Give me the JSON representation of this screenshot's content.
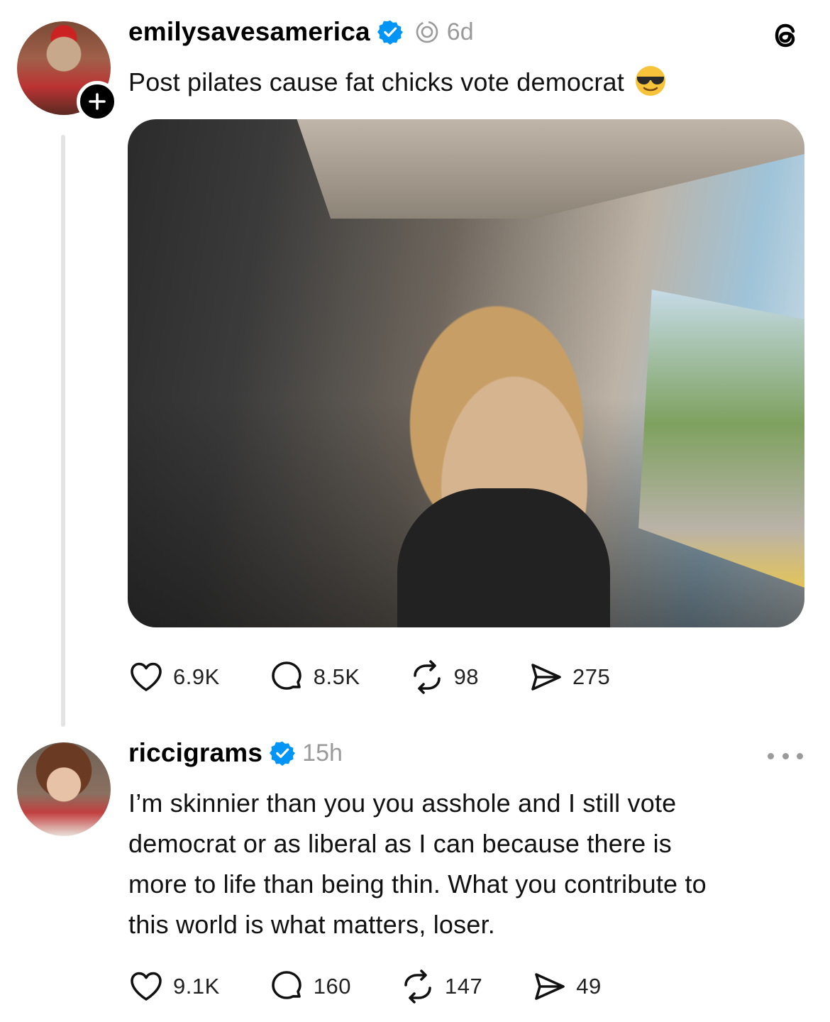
{
  "app": "Threads",
  "post": {
    "username": "emilysavesamerica",
    "verified": true,
    "time": "6d",
    "text": "Post pilates cause fat chicks vote democrat",
    "emoji": "smiling-face-with-sunglasses",
    "stats": {
      "likes": "6.9K",
      "replies": "8.5K",
      "reposts": "98",
      "shares": "275"
    }
  },
  "reply": {
    "username": "riccigrams",
    "verified": true,
    "time": "15h",
    "lines": [
      "I’m skinnier than you you asshole and I still vote",
      "democrat or as liberal as I can because there is",
      "more to life than being thin. What you contribute to",
      "this world is what matters, loser."
    ],
    "stats": {
      "likes": "9.1K",
      "replies": "160",
      "reposts": "147",
      "shares": "49"
    }
  },
  "colors": {
    "verified_blue": "#0095f6",
    "muted": "#9a9a9a",
    "thread_line": "#e3e3e3"
  }
}
